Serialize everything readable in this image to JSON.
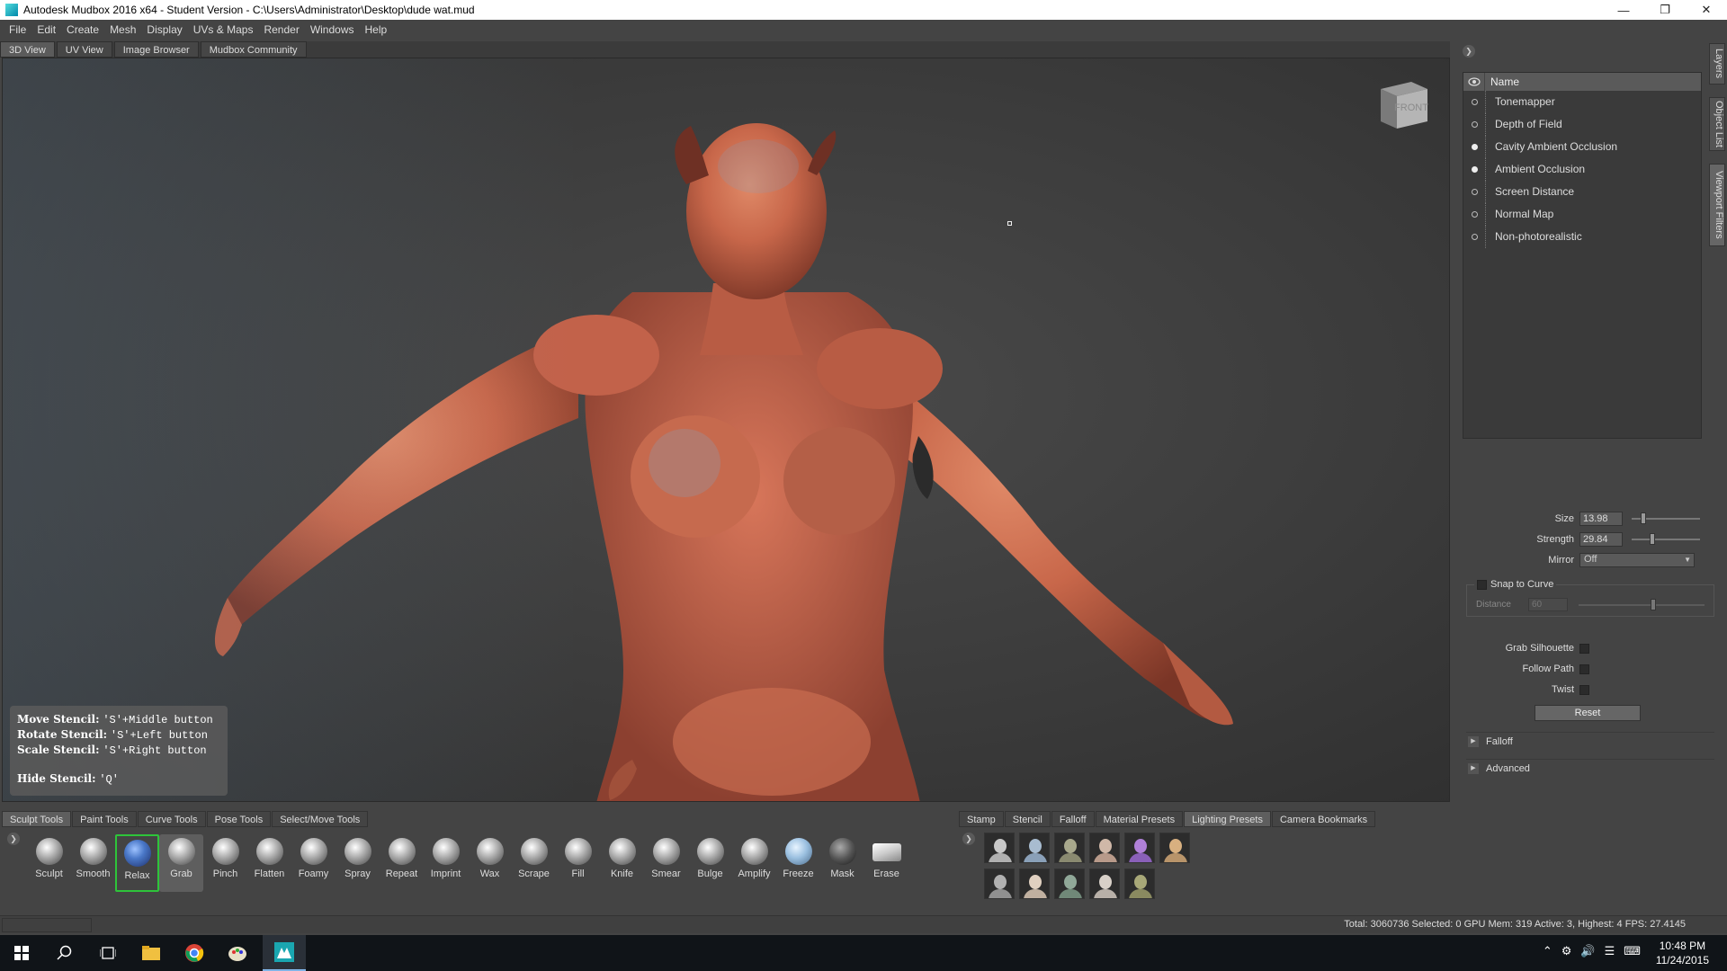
{
  "window": {
    "title": "Autodesk Mudbox 2016 x64 - Student Version - C:\\Users\\Administrator\\Desktop\\dude wat.mud"
  },
  "menu": [
    "File",
    "Edit",
    "Create",
    "Mesh",
    "Display",
    "UVs & Maps",
    "Render",
    "Windows",
    "Help"
  ],
  "view_tabs": [
    "3D View",
    "UV View",
    "Image Browser",
    "Mudbox Community"
  ],
  "viewcube_label": "FRONT",
  "stencil_help": {
    "move_label": "Move Stencil:",
    "move_keys": "'S'+Middle button",
    "rotate_label": "Rotate Stencil:",
    "rotate_keys": "'S'+Left button",
    "scale_label": "Scale Stencil:",
    "scale_keys": "'S'+Right button",
    "hide_label": "Hide Stencil:",
    "hide_keys": "'Q'"
  },
  "side_tabs": [
    "Layers",
    "Object List",
    "Viewport Filters"
  ],
  "viewport_filters": {
    "header": "Name",
    "items": [
      {
        "label": "Tonemapper",
        "enabled": false
      },
      {
        "label": "Depth of Field",
        "enabled": false
      },
      {
        "label": "Cavity Ambient Occlusion",
        "enabled": true
      },
      {
        "label": "Ambient Occlusion",
        "enabled": true
      },
      {
        "label": "Screen Distance",
        "enabled": false
      },
      {
        "label": "Normal Map",
        "enabled": false
      },
      {
        "label": "Non-photorealistic",
        "enabled": false
      }
    ]
  },
  "properties": {
    "size_label": "Size",
    "size_value": "13.98",
    "strength_label": "Strength",
    "strength_value": "29.84",
    "mirror_label": "Mirror",
    "mirror_value": "Off",
    "snap_label": "Snap to Curve",
    "distance_label": "Distance",
    "distance_value": "60",
    "grab_silhouette_label": "Grab Silhouette",
    "follow_path_label": "Follow Path",
    "twist_label": "Twist",
    "reset_label": "Reset",
    "falloff_label": "Falloff",
    "advanced_label": "Advanced"
  },
  "tray_tabs_left": [
    "Sculpt Tools",
    "Paint Tools",
    "Curve Tools",
    "Pose Tools",
    "Select/Move Tools"
  ],
  "tray_tabs_right": [
    "Stamp",
    "Stencil",
    "Falloff",
    "Material Presets",
    "Lighting Presets",
    "Camera Bookmarks"
  ],
  "tools": [
    "Sculpt",
    "Smooth",
    "Relax",
    "Grab",
    "Pinch",
    "Flatten",
    "Foamy",
    "Spray",
    "Repeat",
    "Imprint",
    "Wax",
    "Scrape",
    "Fill",
    "Knife",
    "Smear",
    "Bulge",
    "Amplify",
    "Freeze",
    "Mask",
    "Erase"
  ],
  "selected_tool": "Grab",
  "status": "Total: 3060736  Selected: 0 GPU Mem: 319  Active: 3, Highest: 4  FPS: 27.4145",
  "clock": {
    "time": "10:48 PM",
    "date": "11/24/2015"
  },
  "colors": {
    "accent_green": "#2ec43a",
    "skin": "#c8674a",
    "panel": "#444444"
  }
}
